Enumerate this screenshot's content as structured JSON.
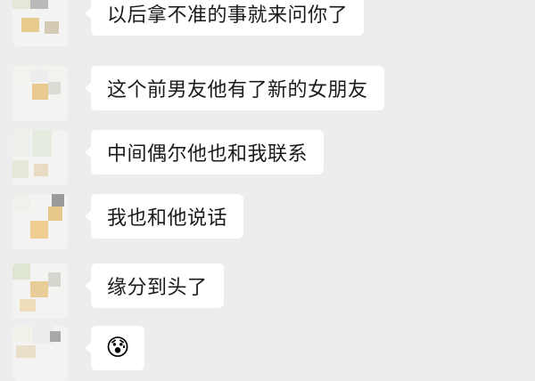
{
  "messages": [
    {
      "text": "以后拿不准的事就来问你了"
    },
    {
      "text": "这个前男友他有了新的女朋友"
    },
    {
      "text": "中间偶尔他也和我联系"
    },
    {
      "text": "我也和他说话"
    },
    {
      "text": "缘分到头了"
    },
    {
      "emoji": "😰",
      "emoji_name": "anxious-face-icon"
    }
  ],
  "colors": {
    "background": "#ededed",
    "bubble": "#ffffff",
    "text": "#1a1a1a"
  }
}
